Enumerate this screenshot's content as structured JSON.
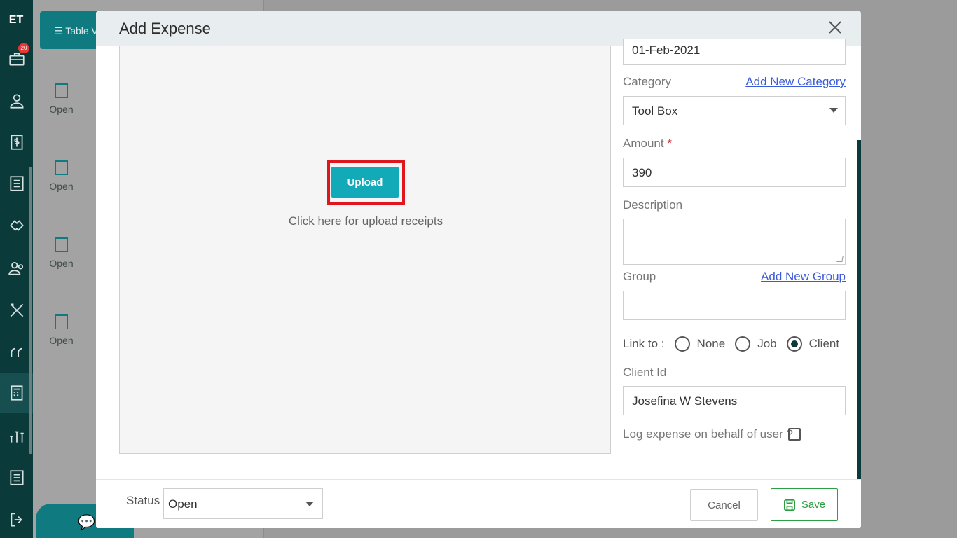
{
  "app": {
    "logo_text": "ET",
    "badge_count": "20"
  },
  "background": {
    "table_view_label": "Table V",
    "open_items": [
      "Open",
      "Open",
      "Open",
      "Open"
    ],
    "chat_label": "Ch"
  },
  "modal": {
    "title": "Add Expense",
    "upload": {
      "button_label": "Upload",
      "hint": "Click here for upload receipts"
    },
    "form": {
      "date_value": "01-Feb-2021",
      "category_label": "Category",
      "add_category_link": "Add New Category",
      "category_value": "Tool Box",
      "amount_label": "Amount",
      "amount_required_mark": "*",
      "amount_value": "390",
      "description_label": "Description",
      "description_value": "",
      "group_label": "Group",
      "add_group_link": "Add New Group",
      "group_value": "",
      "link_to_label": "Link to :",
      "link_options": [
        "None",
        "Job",
        "Client"
      ],
      "link_selected": "Client",
      "client_id_label": "Client Id",
      "client_id_value": "Josefina W Stevens",
      "log_on_behalf_label": "Log expense on behalf of user ?",
      "log_on_behalf_checked": false
    },
    "footer": {
      "status_label": "Status",
      "status_value": "Open",
      "cancel_label": "Cancel",
      "save_label": "Save"
    }
  },
  "colors": {
    "sidebar": "#0b3a3b",
    "upload_button": "#12a9b8",
    "highlight": "#e0161f",
    "save": "#2e9e45",
    "link": "#3b5bdb"
  }
}
